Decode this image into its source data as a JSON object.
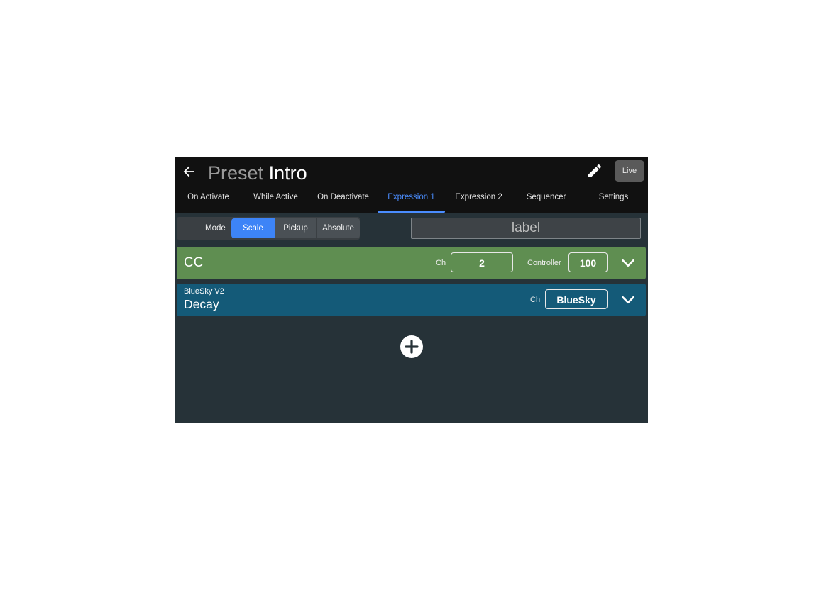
{
  "header": {
    "title_prefix": "Preset",
    "title_name": "Intro",
    "live_label": "Live"
  },
  "tabs": [
    {
      "label": "On Activate"
    },
    {
      "label": "While Active"
    },
    {
      "label": "On Deactivate"
    },
    {
      "label": "Expression 1",
      "active": true
    },
    {
      "label": "Expression 2"
    },
    {
      "label": "Sequencer"
    },
    {
      "label": "Settings"
    }
  ],
  "mode": {
    "label": "Mode",
    "options": [
      "Scale",
      "Pickup",
      "Absolute"
    ],
    "selected": "Scale"
  },
  "label_field": {
    "placeholder": "label",
    "value": ""
  },
  "messages": [
    {
      "type": "CC",
      "ch_label": "Ch",
      "ch_value": "2",
      "controller_label": "Controller",
      "controller_value": "100",
      "color": "#5f8e51"
    },
    {
      "device": "BlueSky V2",
      "name": "Decay",
      "ch_label": "Ch",
      "ch_value": "BlueSky",
      "color": "#145a78"
    }
  ],
  "icons": {
    "back": "arrow-left-icon",
    "edit": "pencil-icon",
    "expand": "chevron-down-icon",
    "add": "plus-circle-icon"
  },
  "colors": {
    "accent": "#3d84f7",
    "tab_active": "#4a8dff",
    "background": "#263238",
    "topbar": "#111111"
  }
}
